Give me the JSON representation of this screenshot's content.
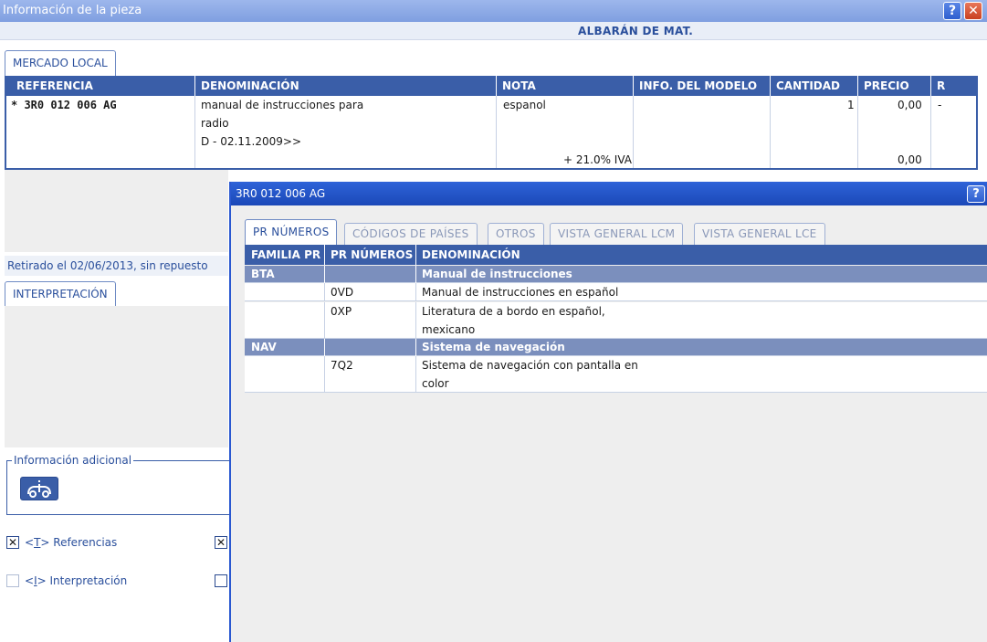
{
  "window": {
    "title": "Información de la pieza",
    "help_label": "?",
    "close_label": "✕",
    "header_label": "ALBARÁN DE MAT."
  },
  "tabs": {
    "mercado_local": "MERCADO LOCAL",
    "interpretacion": "INTERPRETACIÓN"
  },
  "parts_table": {
    "columns": [
      "REFERENCIA",
      "DENOMINACIÓN",
      "NOTA",
      "INFO. DEL MODELO",
      "CANTIDAD",
      "PRECIO",
      "R"
    ],
    "row": {
      "referencia": "* 3R0 012 006 AG",
      "denominacion_line1": "manual de instrucciones para",
      "denominacion_line2": "radio",
      "denominacion_line3": "D - 02.11.2009>>",
      "nota": "espanol",
      "iva": "+ 21.0% IVA",
      "cantidad": "1",
      "precio": "0,00",
      "precio_total": "0,00",
      "r": "-"
    }
  },
  "status": {
    "retirado": "Retirado el 02/06/2013, sin repuesto"
  },
  "info_adicional": {
    "legend": "Información adicional",
    "icon": "car-info-icon"
  },
  "checkboxes": [
    {
      "label_prefix": "<",
      "label_key": "T",
      "label_rest": "> Referencias",
      "checked": true,
      "mark": "✕"
    },
    {
      "label_prefix": "<",
      "label_key": "I",
      "label_rest": "> Interpretación",
      "checked": false,
      "mark": ""
    }
  ],
  "right_checkboxes": [
    {
      "checked": true,
      "mark": "✕"
    },
    {
      "checked": false,
      "mark": ""
    }
  ],
  "dialog": {
    "title": "3R0 012 006 AG",
    "help_label": "?",
    "tabs": [
      "PR NÚMEROS",
      "CÓDIGOS DE PAÍSES",
      "OTROS",
      "VISTA GENERAL LCM",
      "VISTA GENERAL LCE"
    ],
    "columns": [
      "FAMILIA PR",
      "PR NÚMEROS",
      "DENOMINACIÓN"
    ],
    "groups": [
      {
        "familia": "BTA",
        "denominacion": "Manual de instrucciones",
        "items": [
          {
            "pr": "0VD",
            "line1": "Manual de instrucciones en español",
            "line2": ""
          },
          {
            "pr": "0XP",
            "line1": "Literatura de a bordo en español,",
            "line2": "mexicano"
          }
        ]
      },
      {
        "familia": "NAV",
        "denominacion": "Sistema de navegación",
        "items": [
          {
            "pr": "7Q2",
            "line1": "Sistema de navegación con pantalla en",
            "line2": "color"
          }
        ]
      }
    ]
  }
}
